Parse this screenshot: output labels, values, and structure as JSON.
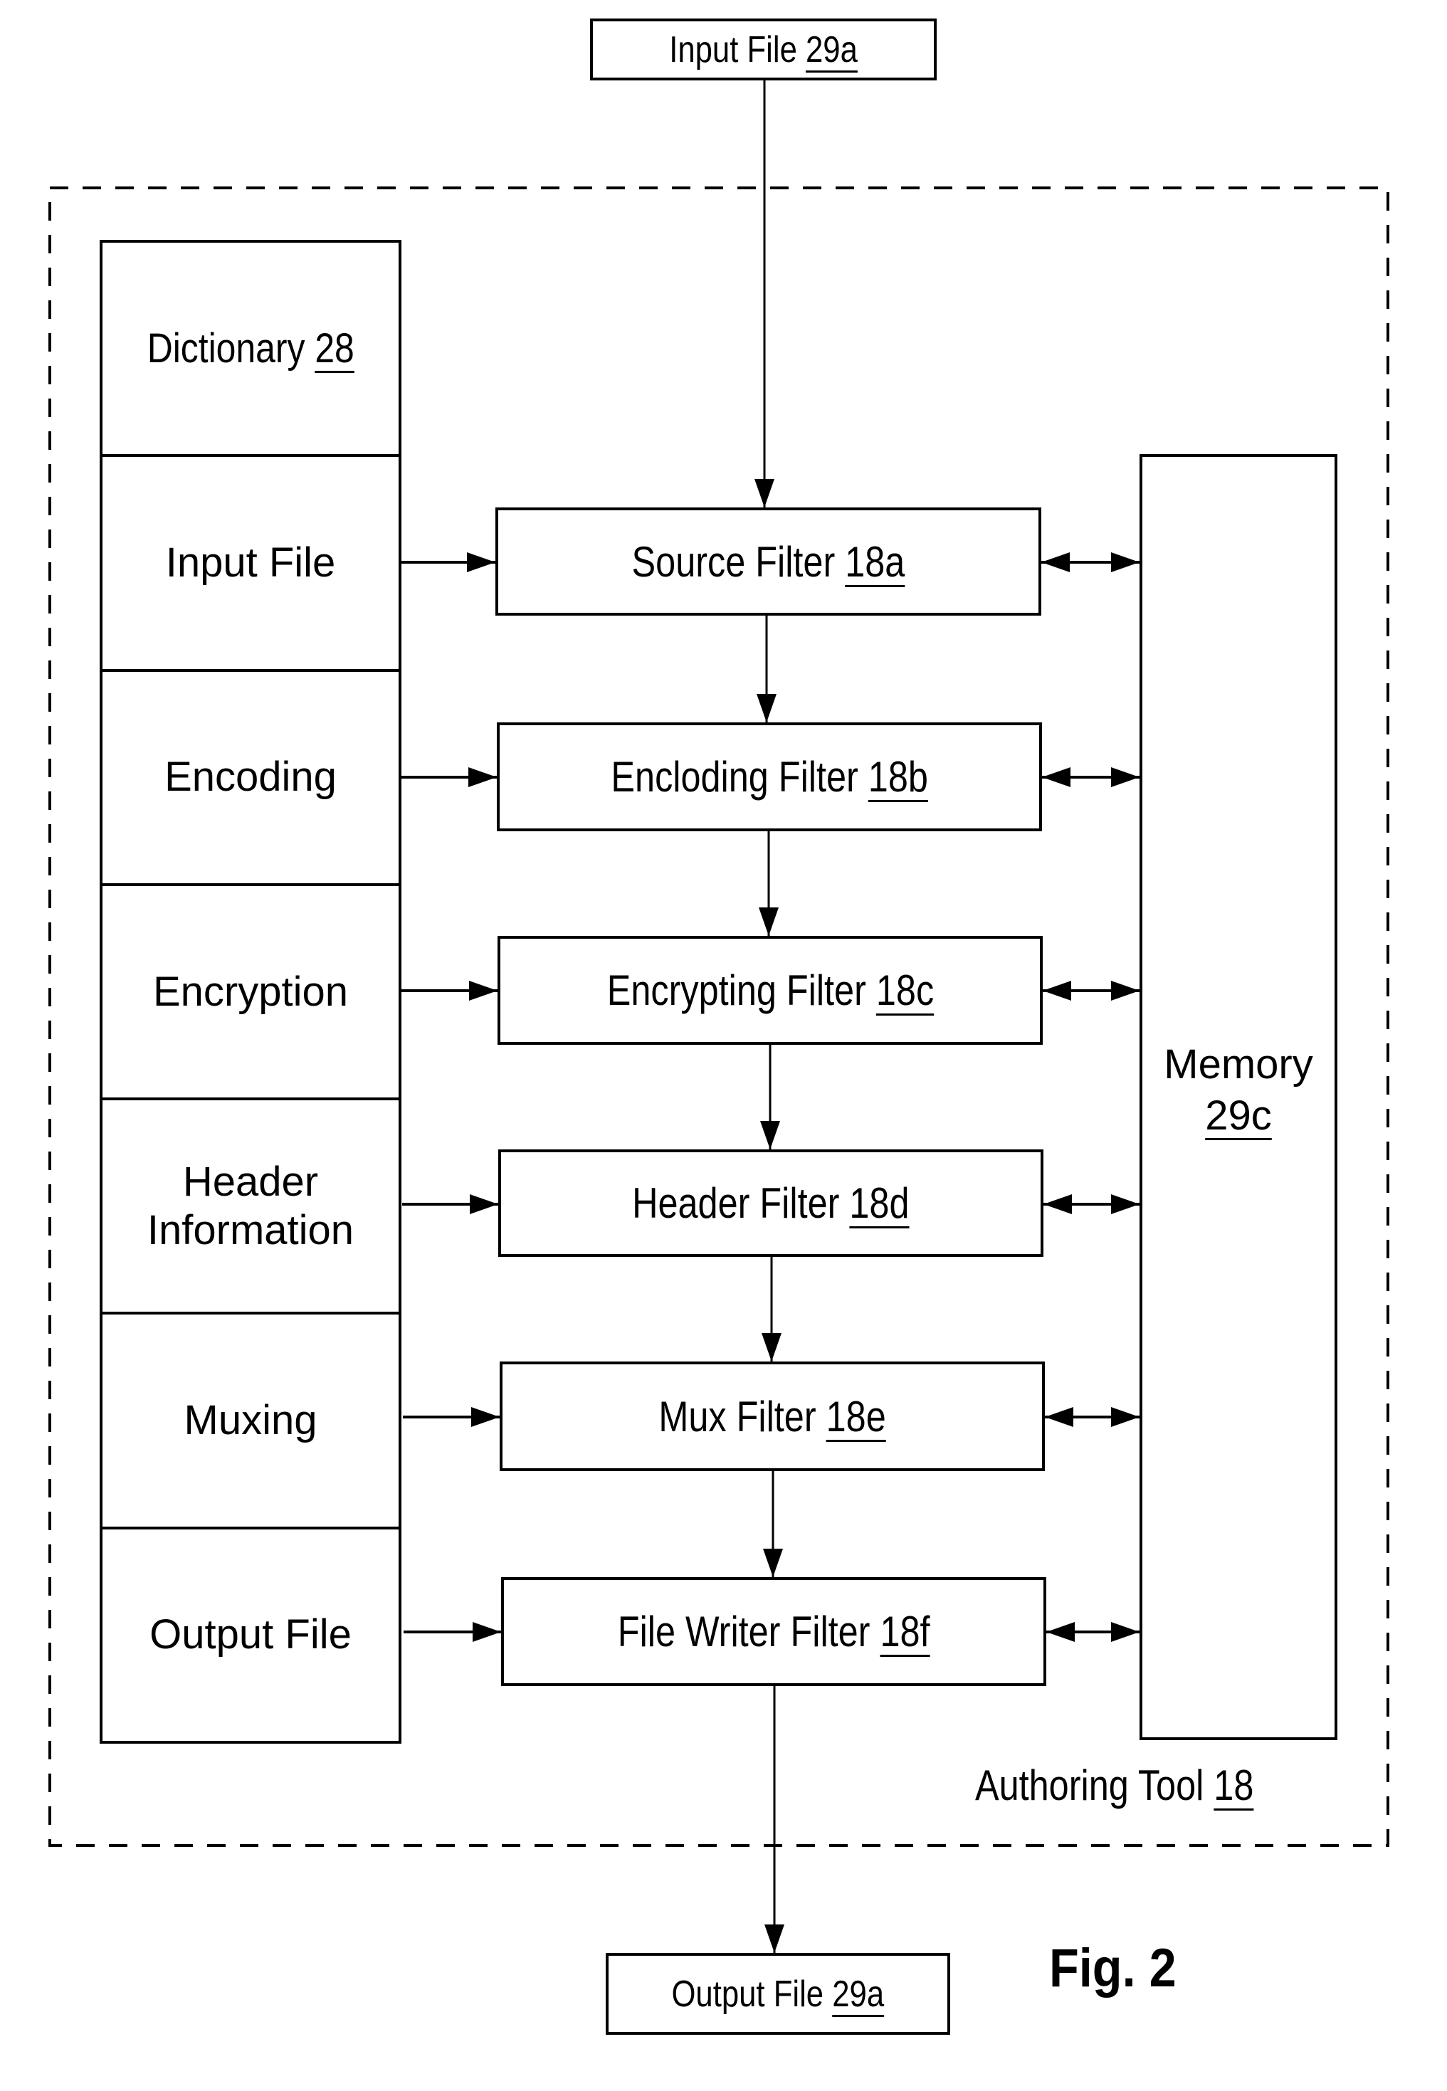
{
  "figure": {
    "label": "Fig. 2"
  },
  "input_file": {
    "name": "Input File",
    "ref": "29a"
  },
  "output_file": {
    "name": "Output File",
    "ref": "29a"
  },
  "authoring_tool": {
    "name": "Authoring Tool",
    "ref": "18"
  },
  "dictionary": {
    "title": "Dictionary",
    "ref": "28",
    "entries": [
      {
        "line1": "Input File",
        "line2": ""
      },
      {
        "line1": "Encoding",
        "line2": ""
      },
      {
        "line1": "Encryption",
        "line2": ""
      },
      {
        "line1": "Header",
        "line2": "Information"
      },
      {
        "line1": "Muxing",
        "line2": ""
      },
      {
        "line1": "Output File",
        "line2": ""
      }
    ]
  },
  "filters": [
    {
      "name": "Source Filter",
      "ref": "18a"
    },
    {
      "name": "Encloding Filter",
      "ref": "18b"
    },
    {
      "name": "Encrypting Filter",
      "ref": "18c"
    },
    {
      "name": "Header Filter",
      "ref": "18d"
    },
    {
      "name": "Mux Filter",
      "ref": "18e"
    },
    {
      "name": "File Writer Filter",
      "ref": "18f"
    }
  ],
  "memory": {
    "name": "Memory",
    "ref": "29c"
  }
}
